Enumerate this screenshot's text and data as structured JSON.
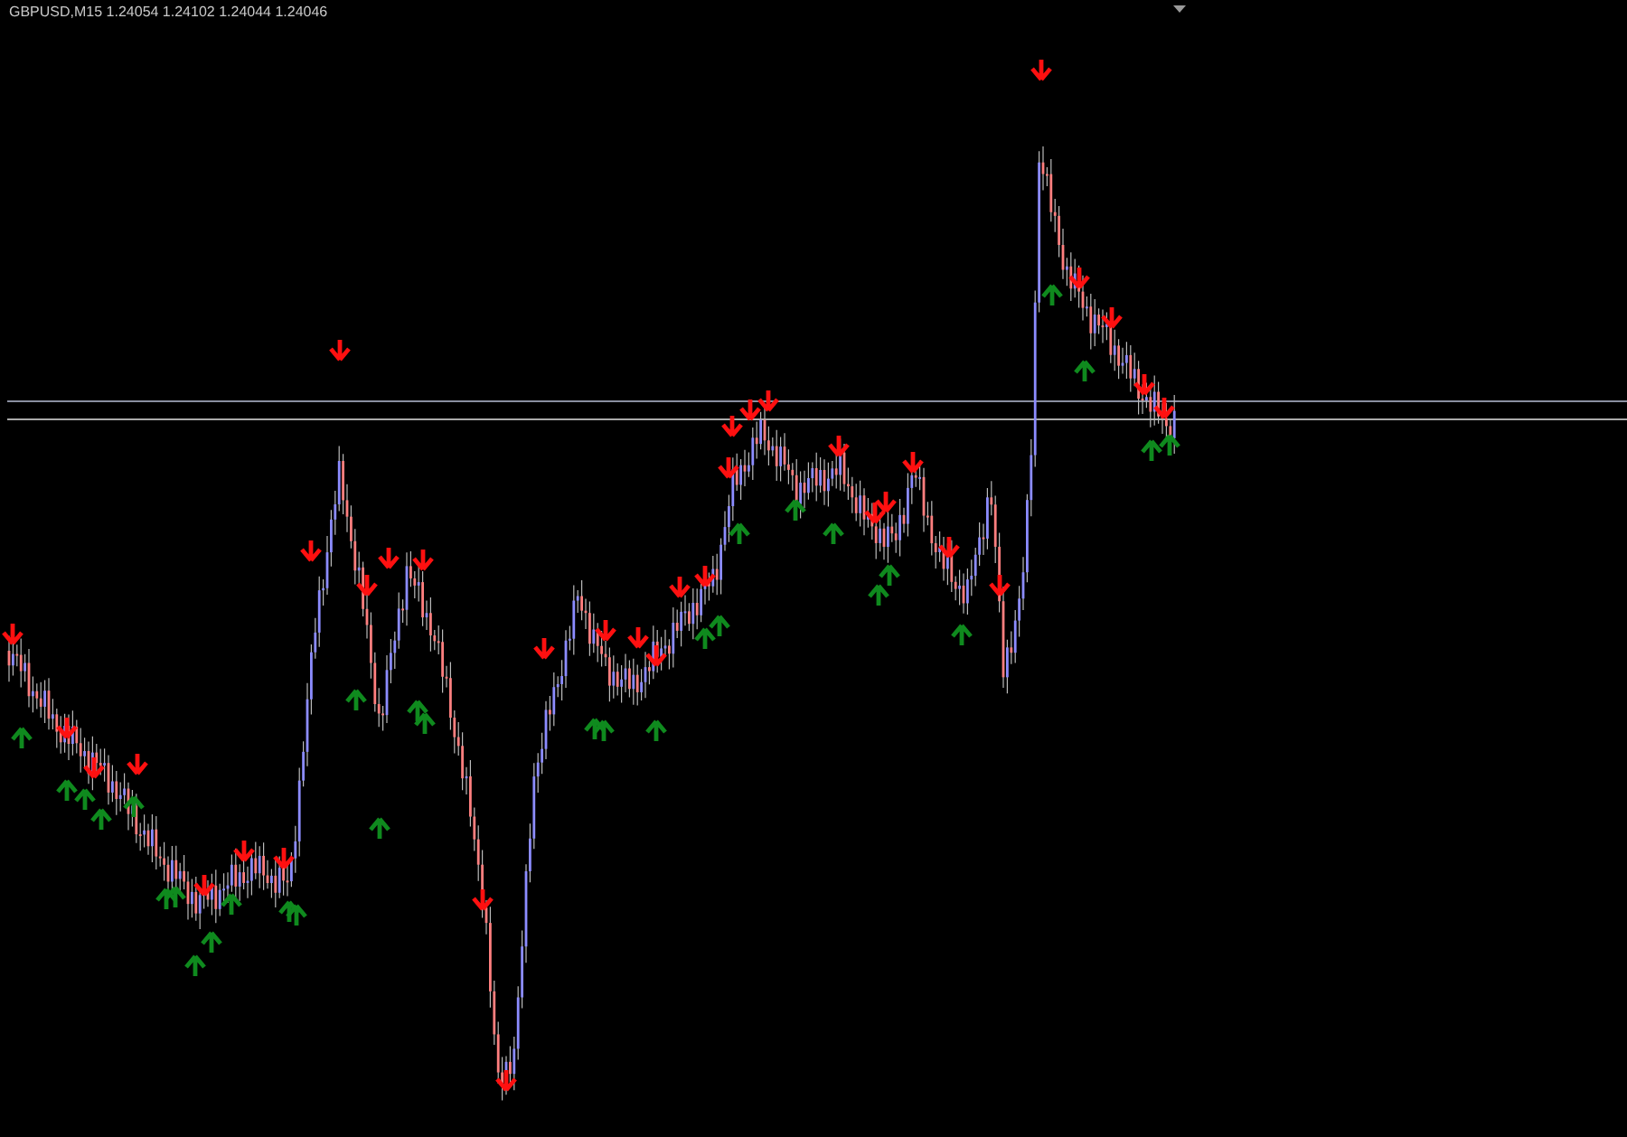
{
  "chart": {
    "title": "GBPUSD,M15  1.24054 1.24102 1.24044 1.24046"
  }
}
